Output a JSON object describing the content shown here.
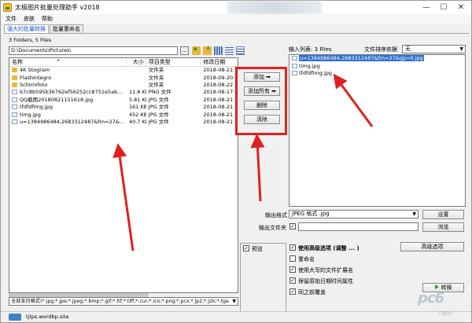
{
  "window": {
    "title": "太极图片批量处理助手  v2018",
    "title_blurred_region": "",
    "controls": {
      "minimize": "—",
      "maximize": "☐",
      "close": "✕"
    }
  },
  "menu": [
    "文件",
    "皮肤",
    "帮助"
  ],
  "tabs": [
    {
      "label": "强大的批量转换",
      "active": true
    },
    {
      "label": "批量重命名",
      "active": false
    }
  ],
  "folder_count": "3 Folders, 5 Files",
  "path": {
    "value": "D:\\Documents\\Pictures\\",
    "browse_label": "..."
  },
  "file_list": {
    "columns": {
      "name": "名称",
      "size": "大小",
      "type": "项目类型",
      "date": "修改日期"
    },
    "sort_indicator": "^",
    "rows": [
      {
        "name": "4K Stogram",
        "size": "",
        "type": "文件夹",
        "date": "2018-08-21 14",
        "kind": "folder"
      },
      {
        "name": "FlashIntegro",
        "size": "",
        "type": "文件夹",
        "date": "2018-09-20 15",
        "kind": "folder"
      },
      {
        "name": "Schirmfoto",
        "size": "",
        "type": "文件夹",
        "date": "2018-08-22 17",
        "kind": "folder"
      },
      {
        "name": "b7c8b595b36762ef56252cc8751e5ab...",
        "size": "11.8 KB",
        "type": "PNG 文件",
        "date": "2018-08-17 16",
        "kind": "image"
      },
      {
        "name": "QQ截图20180821151618.jpg",
        "size": "5.81 KB",
        "type": "JPG 文件",
        "date": "2018-08-21 15",
        "kind": "image"
      },
      {
        "name": "tfdfdfimg.jpg",
        "size": "161 KB",
        "type": "JPG 文件",
        "date": "2018-08-21 15",
        "kind": "image"
      },
      {
        "name": "timg.jpg",
        "size": "452 KB",
        "type": "JPG 文件",
        "date": "2018-08-21 15",
        "kind": "image"
      },
      {
        "name": "u=1384986484,2683312487&fm=27&...",
        "size": "40.7 KB",
        "type": "JPG 文件",
        "date": "2018-08-21 15",
        "kind": "image"
      }
    ]
  },
  "filter": {
    "value": "全部支持格式(*.jpg;*.jpe;*.jpeg;*.bmp;*.gif;*.tif;*.tiff;*.cur;*.ico;*.png;*.pcx;*.jp2;*.j2k;*.tga"
  },
  "actions": {
    "add": "添加 ➡",
    "add_all": "添加所有 ➡",
    "delete": "删除",
    "clear": "清除"
  },
  "input_list": {
    "label": "输入列表:  3 Files",
    "sort_label": "文件排序依据",
    "sort_value": "无",
    "items": [
      {
        "name": "u=1384986484,2683312487&fm=27&gp=0.jpg",
        "selected": true
      },
      {
        "name": "timg.jpg",
        "selected": false
      },
      {
        "name": "tfdfdfimg.jpg",
        "selected": false
      }
    ]
  },
  "output": {
    "format_label": "输出格式",
    "format_value": "JPEG 格式 .jpg",
    "settings_button": "设置",
    "folder_label": "输出文件夹",
    "folder_checked": true,
    "folder_value": "",
    "browse_button": "浏览"
  },
  "preview": {
    "label": "预览",
    "checked": true
  },
  "options": {
    "use_advanced": {
      "label": "使用高级选项 (调整 ... )",
      "checked": true
    },
    "advanced_button": "高级选项",
    "rename": {
      "label": "重命名",
      "checked": false
    },
    "uppercase_ext": {
      "label": "使用大写的文件扩展名",
      "checked": true
    },
    "keep_date": {
      "label": "保留原始日期时间属性",
      "checked": true
    },
    "overwrite": {
      "label": "同之前覆盖",
      "checked": true
    }
  },
  "start_button": "转换",
  "status": {
    "text": "tjtps.wordbp.site"
  },
  "watermark": {
    "text": "pc6",
    "sub": "下载站"
  },
  "colors": {
    "highlight_border": "#e02020",
    "arrow": "#e02020",
    "selection": "#3271d1",
    "active_tab": "#1a56c9"
  }
}
